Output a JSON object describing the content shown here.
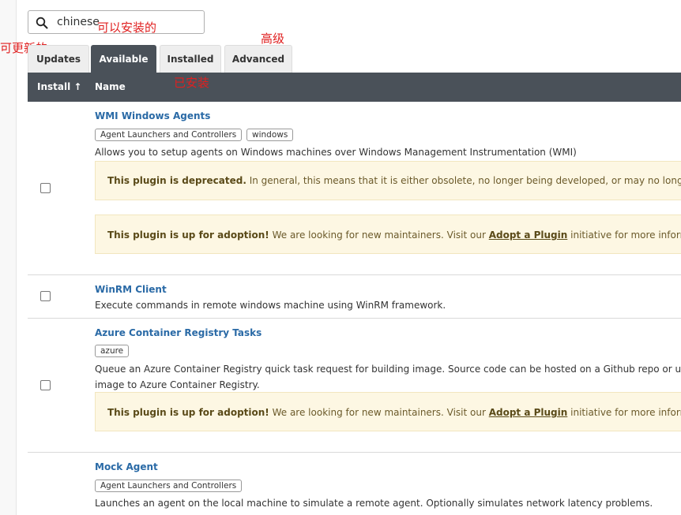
{
  "search": {
    "value": "chinese"
  },
  "annotations": {
    "installable": "可以安装的",
    "updatable": "可更新的",
    "advanced": "高级",
    "installed": "已安装"
  },
  "tabs": [
    {
      "label": "Updates",
      "active": false
    },
    {
      "label": "Available",
      "active": true
    },
    {
      "label": "Installed",
      "active": false
    },
    {
      "label": "Advanced",
      "active": false
    }
  ],
  "table": {
    "col_install": "Install ↑",
    "col_name": "Name"
  },
  "plugins": [
    {
      "name": "WMI Windows Agents",
      "tags": [
        "Agent Launchers and Controllers",
        "windows"
      ],
      "description": "Allows you to setup agents on Windows machines over Windows Management Instrumentation (WMI)",
      "notices": [
        {
          "bold": "This plugin is deprecated.",
          "text": " In general, this means that it is either obsolete, no longer being developed, or may no longer work"
        },
        {
          "bold": "This plugin is up for adoption!",
          "text": " We are looking for new maintainers. Visit our ",
          "link": "Adopt a Plugin",
          "after": " initiative for more information."
        }
      ]
    },
    {
      "name": "WinRM Client",
      "tags": [],
      "description": "Execute commands in remote windows machine using WinRM framework."
    },
    {
      "name": "Azure Container Registry Tasks",
      "tags": [
        "azure"
      ],
      "description_line1": "Queue an Azure Container Registry quick task request for building image. Source code can be hosted on a Github repo or upload",
      "description_line2": "image to Azure Container Registry.",
      "notices": [
        {
          "bold": "This plugin is up for adoption!",
          "text": " We are looking for new maintainers. Visit our ",
          "link": "Adopt a Plugin",
          "after": " initiative for more information."
        }
      ]
    },
    {
      "name": "Mock Agent",
      "tags": [
        "Agent Launchers and Controllers"
      ],
      "description": "Launches an agent on the local machine to simulate a remote agent. Optionally simulates network latency problems."
    }
  ]
}
